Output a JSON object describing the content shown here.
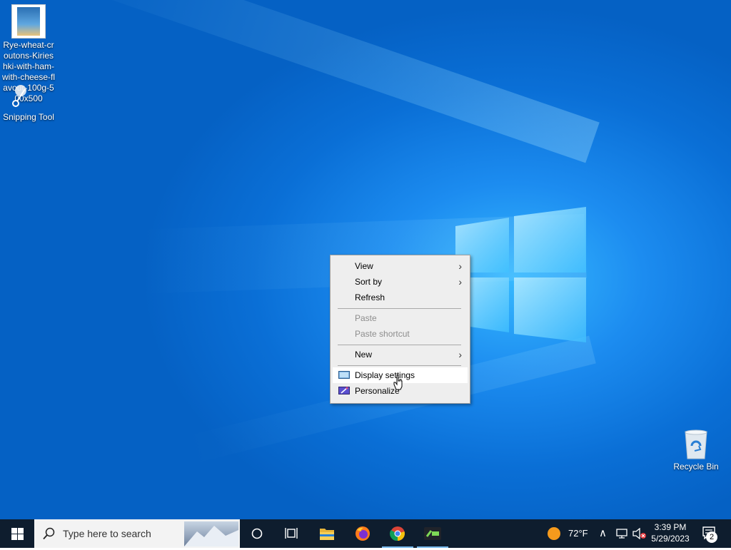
{
  "desktop": {
    "icons": [
      {
        "label": "Rye-wheat-croutons-Kirieshki-with-ham-with-cheese-flavour-100g-500x500",
        "icon": "image-file-icon"
      },
      {
        "label": "Snipping Tool",
        "icon": "snipping-tool-icon"
      },
      {
        "label": "Recycle Bin",
        "icon": "recycle-bin-icon"
      }
    ]
  },
  "context_menu": {
    "items": [
      {
        "label": "View",
        "submenu": true,
        "enabled": true
      },
      {
        "label": "Sort by",
        "submenu": true,
        "enabled": true
      },
      {
        "label": "Refresh",
        "submenu": false,
        "enabled": true
      },
      {
        "label": "Paste",
        "submenu": false,
        "enabled": false
      },
      {
        "label": "Paste shortcut",
        "submenu": false,
        "enabled": false
      },
      {
        "label": "New",
        "submenu": true,
        "enabled": true
      },
      {
        "label": "Display settings",
        "submenu": false,
        "enabled": true,
        "icon": "display-icon",
        "hovered": true
      },
      {
        "label": "Personalize",
        "submenu": false,
        "enabled": true,
        "icon": "personalize-icon"
      }
    ]
  },
  "taskbar": {
    "search_placeholder": "Type here to search",
    "apps": [
      "cortana-icon",
      "task-view-icon",
      "file-explorer-icon",
      "firefox-icon",
      "chrome-icon",
      "terminal-app-icon"
    ],
    "weather": "72°F",
    "time": "3:39 PM",
    "date": "5/29/2023",
    "notification_count": "2"
  },
  "colors": {
    "taskbar_bg": "#0e1d2e",
    "accent": "#76b9ed",
    "menu_bg": "#eeeeee"
  }
}
